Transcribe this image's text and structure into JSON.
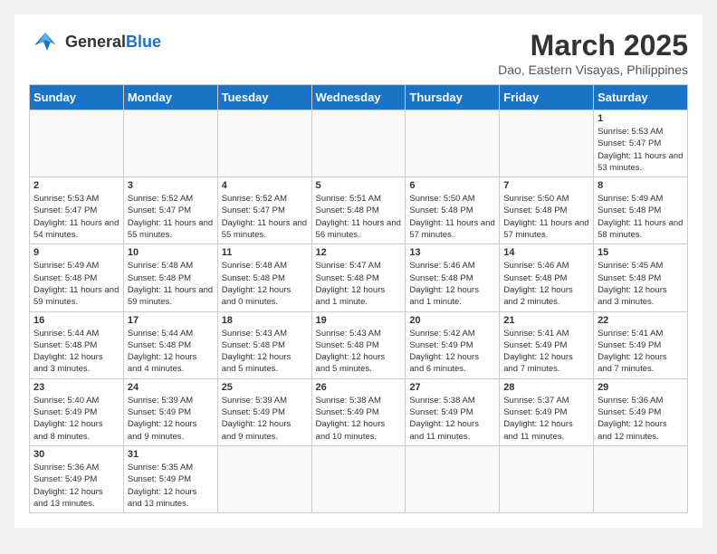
{
  "logo": {
    "text_general": "General",
    "text_blue": "Blue"
  },
  "title": "March 2025",
  "subtitle": "Dao, Eastern Visayas, Philippines",
  "weekdays": [
    "Sunday",
    "Monday",
    "Tuesday",
    "Wednesday",
    "Thursday",
    "Friday",
    "Saturday"
  ],
  "weeks": [
    [
      {
        "day": "",
        "info": ""
      },
      {
        "day": "",
        "info": ""
      },
      {
        "day": "",
        "info": ""
      },
      {
        "day": "",
        "info": ""
      },
      {
        "day": "",
        "info": ""
      },
      {
        "day": "",
        "info": ""
      },
      {
        "day": "1",
        "info": "Sunrise: 5:53 AM\nSunset: 5:47 PM\nDaylight: 11 hours and 53 minutes."
      }
    ],
    [
      {
        "day": "2",
        "info": "Sunrise: 5:53 AM\nSunset: 5:47 PM\nDaylight: 11 hours and 54 minutes."
      },
      {
        "day": "3",
        "info": "Sunrise: 5:52 AM\nSunset: 5:47 PM\nDaylight: 11 hours and 55 minutes."
      },
      {
        "day": "4",
        "info": "Sunrise: 5:52 AM\nSunset: 5:47 PM\nDaylight: 11 hours and 55 minutes."
      },
      {
        "day": "5",
        "info": "Sunrise: 5:51 AM\nSunset: 5:48 PM\nDaylight: 11 hours and 56 minutes."
      },
      {
        "day": "6",
        "info": "Sunrise: 5:50 AM\nSunset: 5:48 PM\nDaylight: 11 hours and 57 minutes."
      },
      {
        "day": "7",
        "info": "Sunrise: 5:50 AM\nSunset: 5:48 PM\nDaylight: 11 hours and 57 minutes."
      },
      {
        "day": "8",
        "info": "Sunrise: 5:49 AM\nSunset: 5:48 PM\nDaylight: 11 hours and 58 minutes."
      }
    ],
    [
      {
        "day": "9",
        "info": "Sunrise: 5:49 AM\nSunset: 5:48 PM\nDaylight: 11 hours and 59 minutes."
      },
      {
        "day": "10",
        "info": "Sunrise: 5:48 AM\nSunset: 5:48 PM\nDaylight: 11 hours and 59 minutes."
      },
      {
        "day": "11",
        "info": "Sunrise: 5:48 AM\nSunset: 5:48 PM\nDaylight: 12 hours and 0 minutes."
      },
      {
        "day": "12",
        "info": "Sunrise: 5:47 AM\nSunset: 5:48 PM\nDaylight: 12 hours and 1 minute."
      },
      {
        "day": "13",
        "info": "Sunrise: 5:46 AM\nSunset: 5:48 PM\nDaylight: 12 hours and 1 minute."
      },
      {
        "day": "14",
        "info": "Sunrise: 5:46 AM\nSunset: 5:48 PM\nDaylight: 12 hours and 2 minutes."
      },
      {
        "day": "15",
        "info": "Sunrise: 5:45 AM\nSunset: 5:48 PM\nDaylight: 12 hours and 3 minutes."
      }
    ],
    [
      {
        "day": "16",
        "info": "Sunrise: 5:44 AM\nSunset: 5:48 PM\nDaylight: 12 hours and 3 minutes."
      },
      {
        "day": "17",
        "info": "Sunrise: 5:44 AM\nSunset: 5:48 PM\nDaylight: 12 hours and 4 minutes."
      },
      {
        "day": "18",
        "info": "Sunrise: 5:43 AM\nSunset: 5:48 PM\nDaylight: 12 hours and 5 minutes."
      },
      {
        "day": "19",
        "info": "Sunrise: 5:43 AM\nSunset: 5:48 PM\nDaylight: 12 hours and 5 minutes."
      },
      {
        "day": "20",
        "info": "Sunrise: 5:42 AM\nSunset: 5:49 PM\nDaylight: 12 hours and 6 minutes."
      },
      {
        "day": "21",
        "info": "Sunrise: 5:41 AM\nSunset: 5:49 PM\nDaylight: 12 hours and 7 minutes."
      },
      {
        "day": "22",
        "info": "Sunrise: 5:41 AM\nSunset: 5:49 PM\nDaylight: 12 hours and 7 minutes."
      }
    ],
    [
      {
        "day": "23",
        "info": "Sunrise: 5:40 AM\nSunset: 5:49 PM\nDaylight: 12 hours and 8 minutes."
      },
      {
        "day": "24",
        "info": "Sunrise: 5:39 AM\nSunset: 5:49 PM\nDaylight: 12 hours and 9 minutes."
      },
      {
        "day": "25",
        "info": "Sunrise: 5:39 AM\nSunset: 5:49 PM\nDaylight: 12 hours and 9 minutes."
      },
      {
        "day": "26",
        "info": "Sunrise: 5:38 AM\nSunset: 5:49 PM\nDaylight: 12 hours and 10 minutes."
      },
      {
        "day": "27",
        "info": "Sunrise: 5:38 AM\nSunset: 5:49 PM\nDaylight: 12 hours and 11 minutes."
      },
      {
        "day": "28",
        "info": "Sunrise: 5:37 AM\nSunset: 5:49 PM\nDaylight: 12 hours and 11 minutes."
      },
      {
        "day": "29",
        "info": "Sunrise: 5:36 AM\nSunset: 5:49 PM\nDaylight: 12 hours and 12 minutes."
      }
    ],
    [
      {
        "day": "30",
        "info": "Sunrise: 5:36 AM\nSunset: 5:49 PM\nDaylight: 12 hours and 13 minutes."
      },
      {
        "day": "31",
        "info": "Sunrise: 5:35 AM\nSunset: 5:49 PM\nDaylight: 12 hours and 13 minutes."
      },
      {
        "day": "",
        "info": ""
      },
      {
        "day": "",
        "info": ""
      },
      {
        "day": "",
        "info": ""
      },
      {
        "day": "",
        "info": ""
      },
      {
        "day": "",
        "info": ""
      }
    ]
  ]
}
